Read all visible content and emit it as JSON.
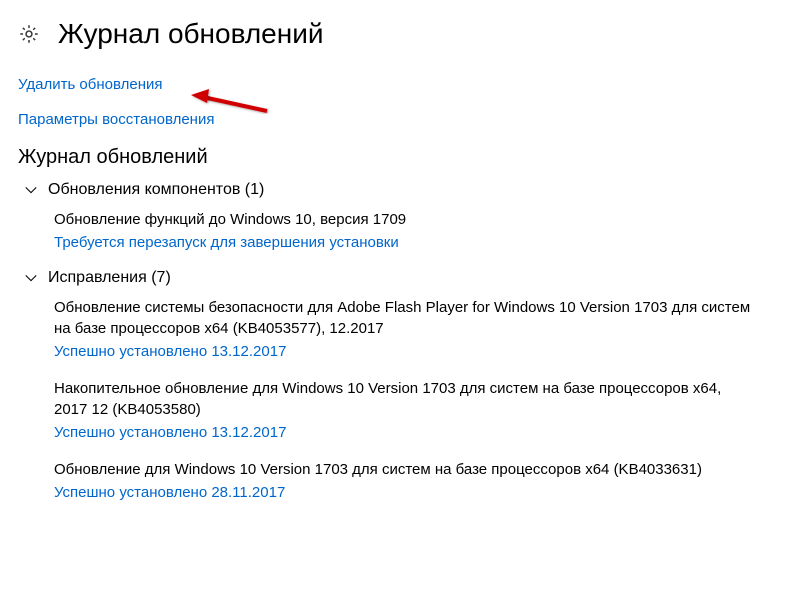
{
  "header": {
    "title": "Журнал обновлений"
  },
  "links": {
    "uninstall": "Удалить обновления",
    "recovery": "Параметры восстановления"
  },
  "section_title": "Журнал обновлений",
  "groups": [
    {
      "label": "Обновления компонентов (1)",
      "items": [
        {
          "title": "Обновление функций до Windows 10, версия 1709",
          "status": "Требуется перезапуск для завершения установки"
        }
      ]
    },
    {
      "label": "Исправления (7)",
      "items": [
        {
          "title": "Обновление системы безопасности для Adobe Flash Player for Windows 10 Version 1703 для систем на базе процессоров x64 (KB4053577), 12.2017",
          "status": "Успешно установлено 13.12.2017"
        },
        {
          "title": "Накопительное обновление для Windows 10 Version 1703 для систем на базе процессоров x64, 2017 12 (KB4053580)",
          "status": "Успешно установлено 13.12.2017"
        },
        {
          "title": "Обновление для Windows 10 Version 1703 для систем на базе процессоров x64 (KB4033631)",
          "status": "Успешно установлено 28.11.2017"
        }
      ]
    }
  ]
}
